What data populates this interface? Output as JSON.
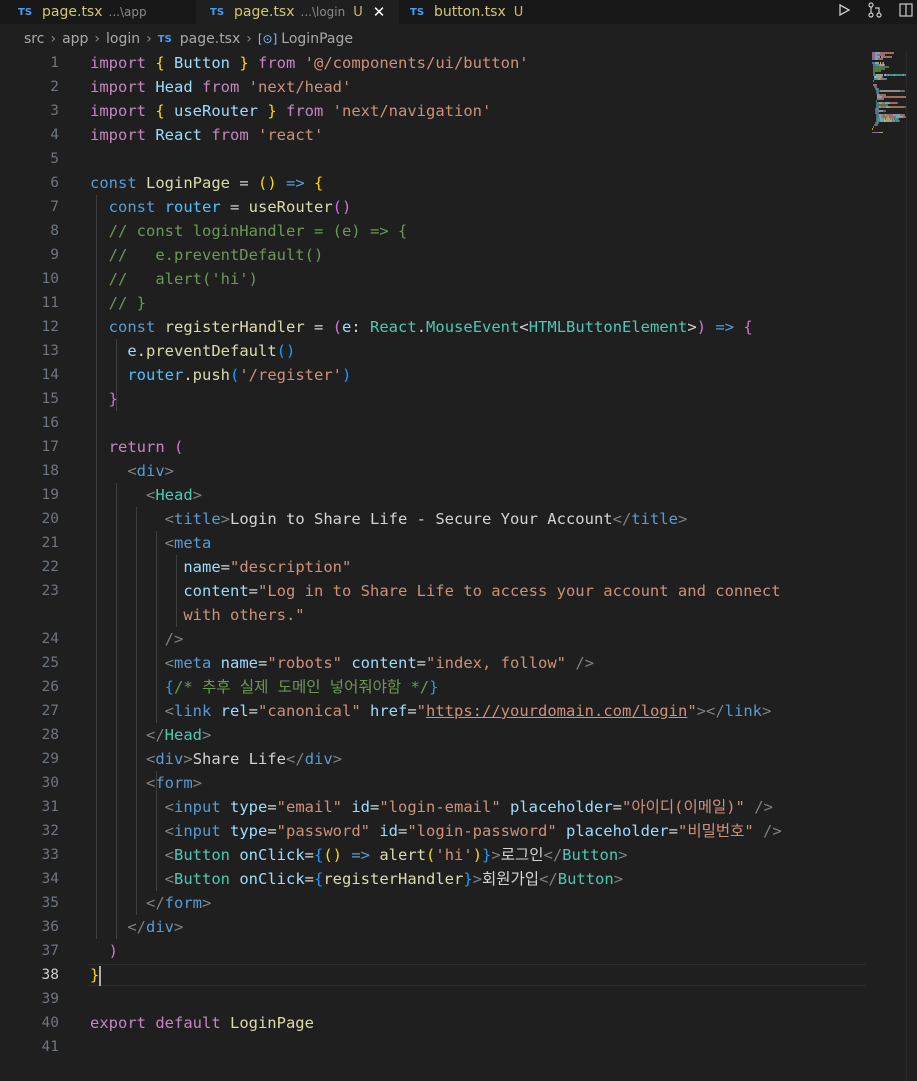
{
  "tabs": [
    {
      "lang": "TS",
      "name": "page.tsx",
      "path": "...\\app",
      "status": ""
    },
    {
      "lang": "TS",
      "name": "page.tsx",
      "path": "...\\login",
      "status": "U",
      "close": "✕"
    },
    {
      "lang": "TS",
      "name": "button.tsx",
      "path": "",
      "status": "U"
    }
  ],
  "breadcrumb": {
    "src": "src",
    "app": "app",
    "login": "login",
    "lang": "TS",
    "file": "page.tsx",
    "symbol": "LoginPage"
  },
  "colors": {
    "keyword": "#569cd6",
    "control": "#c586c0",
    "string": "#ce9178",
    "function": "#dcdcaa",
    "variable": "#9cdcfe",
    "type": "#4ec9b0",
    "comment": "#6a9955",
    "background": "#1f1f1f"
  },
  "current_line": 38,
  "lines": [
    {
      "n": "1",
      "code": [
        [
          "import ",
          "ctrl"
        ],
        [
          "{ ",
          "b1"
        ],
        [
          "Button",
          "var"
        ],
        [
          " } ",
          "b1"
        ],
        [
          "from ",
          "ctrl"
        ],
        [
          "'@/components/ui/button'",
          "str"
        ]
      ]
    },
    {
      "n": "2",
      "code": [
        [
          "import ",
          "ctrl"
        ],
        [
          "Head ",
          "var"
        ],
        [
          "from ",
          "ctrl"
        ],
        [
          "'next/head'",
          "str"
        ]
      ]
    },
    {
      "n": "3",
      "code": [
        [
          "import ",
          "ctrl"
        ],
        [
          "{ ",
          "b1"
        ],
        [
          "useRouter",
          "var"
        ],
        [
          " } ",
          "b1"
        ],
        [
          "from ",
          "ctrl"
        ],
        [
          "'next/navigation'",
          "str"
        ]
      ]
    },
    {
      "n": "4",
      "code": [
        [
          "import ",
          "ctrl"
        ],
        [
          "React ",
          "var"
        ],
        [
          "from ",
          "ctrl"
        ],
        [
          "'react'",
          "str"
        ]
      ]
    },
    {
      "n": "5",
      "code": []
    },
    {
      "n": "6",
      "code": [
        [
          "const ",
          "kw"
        ],
        [
          "LoginPage",
          "fn"
        ],
        [
          " = ",
          "txt"
        ],
        [
          "()",
          "b1"
        ],
        [
          " => ",
          "kw"
        ],
        [
          "{",
          "b1"
        ]
      ]
    },
    {
      "n": "7",
      "code": [
        [
          "  ",
          "txt"
        ],
        [
          "const ",
          "kw"
        ],
        [
          "router",
          "cst"
        ],
        [
          " = ",
          "txt"
        ],
        [
          "useRouter",
          "fn"
        ],
        [
          "()",
          "b2"
        ]
      ]
    },
    {
      "n": "8",
      "code": [
        [
          "  // const loginHandler = (e) => {",
          "com"
        ]
      ]
    },
    {
      "n": "9",
      "code": [
        [
          "  //   e.preventDefault()",
          "com"
        ]
      ]
    },
    {
      "n": "10",
      "code": [
        [
          "  //   alert('hi')",
          "com"
        ]
      ]
    },
    {
      "n": "11",
      "code": [
        [
          "  // }",
          "com"
        ]
      ]
    },
    {
      "n": "12",
      "code": [
        [
          "  ",
          "txt"
        ],
        [
          "const ",
          "kw"
        ],
        [
          "registerHandler",
          "fn"
        ],
        [
          " = ",
          "txt"
        ],
        [
          "(",
          "b2"
        ],
        [
          "e",
          "var"
        ],
        [
          ": ",
          "txt"
        ],
        [
          "React",
          "typ"
        ],
        [
          ".",
          "txt"
        ],
        [
          "MouseEvent",
          "typ"
        ],
        [
          "<",
          "txt"
        ],
        [
          "HTMLButtonElement",
          "typ"
        ],
        [
          ">",
          "txt"
        ],
        [
          ")",
          "b2"
        ],
        [
          " => ",
          "kw"
        ],
        [
          "{",
          "b2"
        ]
      ]
    },
    {
      "n": "13",
      "code": [
        [
          "    ",
          "txt"
        ],
        [
          "e",
          "var"
        ],
        [
          ".",
          "txt"
        ],
        [
          "preventDefault",
          "fn"
        ],
        [
          "()",
          "b3"
        ]
      ]
    },
    {
      "n": "14",
      "code": [
        [
          "    ",
          "txt"
        ],
        [
          "router",
          "cst"
        ],
        [
          ".",
          "txt"
        ],
        [
          "push",
          "fn"
        ],
        [
          "(",
          "b3"
        ],
        [
          "'/register'",
          "str"
        ],
        [
          ")",
          "b3"
        ]
      ]
    },
    {
      "n": "15",
      "code": [
        [
          "  ",
          "txt"
        ],
        [
          "}",
          "b2"
        ]
      ]
    },
    {
      "n": "16",
      "code": []
    },
    {
      "n": "17",
      "code": [
        [
          "  ",
          "txt"
        ],
        [
          "return ",
          "ctrl"
        ],
        [
          "(",
          "b2"
        ]
      ]
    },
    {
      "n": "18",
      "code": [
        [
          "    ",
          "txt"
        ],
        [
          "<",
          "ptag"
        ],
        [
          "div",
          "tag"
        ],
        [
          ">",
          "ptag"
        ]
      ]
    },
    {
      "n": "19",
      "code": [
        [
          "      ",
          "txt"
        ],
        [
          "<",
          "ptag"
        ],
        [
          "Head",
          "comp"
        ],
        [
          ">",
          "ptag"
        ]
      ]
    },
    {
      "n": "20",
      "code": [
        [
          "        ",
          "txt"
        ],
        [
          "<",
          "ptag"
        ],
        [
          "title",
          "tag"
        ],
        [
          ">",
          "ptag"
        ],
        [
          "Login to Share Life - Secure Your Account",
          "txt"
        ],
        [
          "</",
          "ptag"
        ],
        [
          "title",
          "tag"
        ],
        [
          ">",
          "ptag"
        ]
      ]
    },
    {
      "n": "21",
      "code": [
        [
          "        ",
          "txt"
        ],
        [
          "<",
          "ptag"
        ],
        [
          "meta",
          "tag"
        ]
      ]
    },
    {
      "n": "22",
      "code": [
        [
          "          ",
          "txt"
        ],
        [
          "name",
          "attr"
        ],
        [
          "=",
          "txt"
        ],
        [
          "\"description\"",
          "str"
        ]
      ]
    },
    {
      "n": "23",
      "code": [
        [
          "          ",
          "txt"
        ],
        [
          "content",
          "attr"
        ],
        [
          "=",
          "txt"
        ],
        [
          "\"Log in to Share Life to access your account and connect",
          "str"
        ]
      ]
    },
    {
      "n": "",
      "code": [
        [
          "          ",
          "txt"
        ],
        [
          "with others.\"",
          "str"
        ]
      ]
    },
    {
      "n": "24",
      "code": [
        [
          "        ",
          "txt"
        ],
        [
          "/>",
          "ptag"
        ]
      ]
    },
    {
      "n": "25",
      "code": [
        [
          "        ",
          "txt"
        ],
        [
          "<",
          "ptag"
        ],
        [
          "meta ",
          "tag"
        ],
        [
          "name",
          "attr"
        ],
        [
          "=",
          "txt"
        ],
        [
          "\"robots\" ",
          "str"
        ],
        [
          "content",
          "attr"
        ],
        [
          "=",
          "txt"
        ],
        [
          "\"index, follow\" ",
          "str"
        ],
        [
          "/>",
          "ptag"
        ]
      ]
    },
    {
      "n": "26",
      "code": [
        [
          "        ",
          "txt"
        ],
        [
          "{",
          "b3"
        ],
        [
          "/* 추후 실제 도메인 넣어줘야함 */",
          "com"
        ],
        [
          "}",
          "b3"
        ]
      ]
    },
    {
      "n": "27",
      "code": [
        [
          "        ",
          "txt"
        ],
        [
          "<",
          "ptag"
        ],
        [
          "link ",
          "tag"
        ],
        [
          "rel",
          "attr"
        ],
        [
          "=",
          "txt"
        ],
        [
          "\"canonical\" ",
          "str"
        ],
        [
          "href",
          "attr"
        ],
        [
          "=",
          "txt"
        ],
        [
          "\"",
          "str"
        ],
        [
          "https://yourdomain.com/login",
          "str ul"
        ],
        [
          "\"",
          "str"
        ],
        [
          "></",
          "ptag"
        ],
        [
          "link",
          "tag"
        ],
        [
          ">",
          "ptag"
        ]
      ]
    },
    {
      "n": "28",
      "code": [
        [
          "      ",
          "txt"
        ],
        [
          "</",
          "ptag"
        ],
        [
          "Head",
          "comp"
        ],
        [
          ">",
          "ptag"
        ]
      ]
    },
    {
      "n": "29",
      "code": [
        [
          "      ",
          "txt"
        ],
        [
          "<",
          "ptag"
        ],
        [
          "div",
          "tag"
        ],
        [
          ">",
          "ptag"
        ],
        [
          "Share Life",
          "txt"
        ],
        [
          "</",
          "ptag"
        ],
        [
          "div",
          "tag"
        ],
        [
          ">",
          "ptag"
        ]
      ]
    },
    {
      "n": "30",
      "code": [
        [
          "      ",
          "txt"
        ],
        [
          "<",
          "ptag"
        ],
        [
          "form",
          "tag"
        ],
        [
          ">",
          "ptag"
        ]
      ]
    },
    {
      "n": "31",
      "code": [
        [
          "        ",
          "txt"
        ],
        [
          "<",
          "ptag"
        ],
        [
          "input ",
          "tag"
        ],
        [
          "type",
          "attr"
        ],
        [
          "=",
          "txt"
        ],
        [
          "\"email\" ",
          "str"
        ],
        [
          "id",
          "attr"
        ],
        [
          "=",
          "txt"
        ],
        [
          "\"login-email\" ",
          "str"
        ],
        [
          "placeholder",
          "attr"
        ],
        [
          "=",
          "txt"
        ],
        [
          "\"아이디(이메일)\" ",
          "str"
        ],
        [
          "/>",
          "ptag"
        ]
      ]
    },
    {
      "n": "32",
      "code": [
        [
          "        ",
          "txt"
        ],
        [
          "<",
          "ptag"
        ],
        [
          "input ",
          "tag"
        ],
        [
          "type",
          "attr"
        ],
        [
          "=",
          "txt"
        ],
        [
          "\"password\" ",
          "str"
        ],
        [
          "id",
          "attr"
        ],
        [
          "=",
          "txt"
        ],
        [
          "\"login-password\" ",
          "str"
        ],
        [
          "placeholder",
          "attr"
        ],
        [
          "=",
          "txt"
        ],
        [
          "\"비밀번호\" ",
          "str"
        ],
        [
          "/>",
          "ptag"
        ]
      ]
    },
    {
      "n": "33",
      "code": [
        [
          "        ",
          "txt"
        ],
        [
          "<",
          "ptag"
        ],
        [
          "Button ",
          "comp"
        ],
        [
          "onClick",
          "attr"
        ],
        [
          "=",
          "txt"
        ],
        [
          "{",
          "b3"
        ],
        [
          "() ",
          "b1"
        ],
        [
          "=> ",
          "kw"
        ],
        [
          "alert",
          "fn"
        ],
        [
          "(",
          "b1"
        ],
        [
          "'hi'",
          "str"
        ],
        [
          ")",
          "b1"
        ],
        [
          "}",
          "b3"
        ],
        [
          ">",
          "ptag"
        ],
        [
          "로그인",
          "txt"
        ],
        [
          "</",
          "ptag"
        ],
        [
          "Button",
          "comp"
        ],
        [
          ">",
          "ptag"
        ]
      ]
    },
    {
      "n": "34",
      "code": [
        [
          "        ",
          "txt"
        ],
        [
          "<",
          "ptag"
        ],
        [
          "Button ",
          "comp"
        ],
        [
          "onClick",
          "attr"
        ],
        [
          "=",
          "txt"
        ],
        [
          "{",
          "b3"
        ],
        [
          "registerHandler",
          "fn"
        ],
        [
          "}",
          "b3"
        ],
        [
          ">",
          "ptag"
        ],
        [
          "회원가입",
          "txt"
        ],
        [
          "</",
          "ptag"
        ],
        [
          "Button",
          "comp"
        ],
        [
          ">",
          "ptag"
        ]
      ]
    },
    {
      "n": "35",
      "code": [
        [
          "      ",
          "txt"
        ],
        [
          "</",
          "ptag"
        ],
        [
          "form",
          "tag"
        ],
        [
          ">",
          "ptag"
        ]
      ]
    },
    {
      "n": "36",
      "code": [
        [
          "    ",
          "txt"
        ],
        [
          "</",
          "ptag"
        ],
        [
          "div",
          "tag"
        ],
        [
          ">",
          "ptag"
        ]
      ]
    },
    {
      "n": "37",
      "code": [
        [
          "  ",
          "txt"
        ],
        [
          ")",
          "b2"
        ]
      ]
    },
    {
      "n": "38",
      "code": [
        [
          "}",
          "b1"
        ]
      ]
    },
    {
      "n": "39",
      "code": []
    },
    {
      "n": "40",
      "code": [
        [
          "export ",
          "ctrl"
        ],
        [
          "default ",
          "ctrl"
        ],
        [
          "LoginPage",
          "fn"
        ]
      ]
    },
    {
      "n": "41",
      "code": []
    }
  ]
}
